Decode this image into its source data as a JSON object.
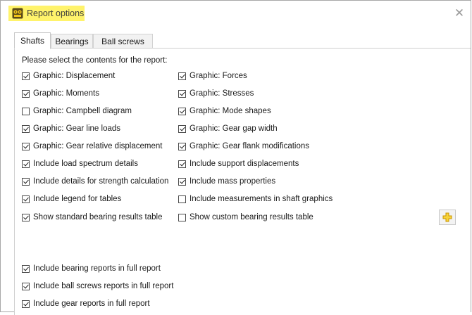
{
  "window": {
    "title": "Report options",
    "close_glyph": "✕",
    "highlight_color": "#fff36b"
  },
  "tabs": [
    {
      "label": "Shafts",
      "active": true
    },
    {
      "label": "Bearings",
      "active": false
    },
    {
      "label": "Ball screws",
      "active": false
    }
  ],
  "panel": {
    "instruction": "Please select the contents for the report:",
    "left_options": [
      {
        "label": "Graphic: Displacement",
        "checked": true
      },
      {
        "label": "Graphic: Moments",
        "checked": true
      },
      {
        "label": "Graphic: Campbell diagram",
        "checked": false
      },
      {
        "label": "Graphic: Gear line loads",
        "checked": true
      },
      {
        "label": "Graphic: Gear relative displacement",
        "checked": true
      },
      {
        "label": "Include load spectrum details",
        "checked": true
      },
      {
        "label": "Include details for strength calculation",
        "checked": true
      },
      {
        "label": "Include legend for tables",
        "checked": true
      },
      {
        "label": "Show standard bearing results table",
        "checked": true
      }
    ],
    "right_options": [
      {
        "label": "Graphic: Forces",
        "checked": true
      },
      {
        "label": "Graphic: Stresses",
        "checked": true
      },
      {
        "label": "Graphic: Mode shapes",
        "checked": true
      },
      {
        "label": "Graphic: Gear gap width",
        "checked": true
      },
      {
        "label": "Graphic: Gear flank modifications",
        "checked": true
      },
      {
        "label": "Include support displacements",
        "checked": true
      },
      {
        "label": "Include mass properties",
        "checked": true
      },
      {
        "label": "Include measurements in shaft graphics",
        "checked": false
      },
      {
        "label": "Show custom bearing results table",
        "checked": false
      }
    ],
    "bottom_options": [
      {
        "label": "Include bearing reports in full report",
        "checked": true
      },
      {
        "label": "Include ball screws reports in full report",
        "checked": true
      },
      {
        "label": "Include gear reports in full report",
        "checked": true
      }
    ],
    "add_button": {
      "icon": "plus-icon",
      "color": "#f2c200"
    }
  }
}
